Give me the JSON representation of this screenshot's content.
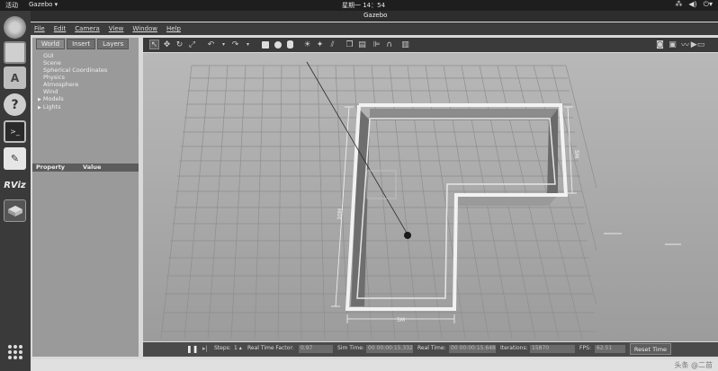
{
  "topbar": {
    "activities": "活动",
    "app_menu": "Gazebo ▾",
    "clock": "星期一 14：54",
    "tray": [
      "network-icon",
      "volume-icon",
      "power-icon"
    ]
  },
  "window": {
    "title": "Gazebo"
  },
  "menu": [
    "File",
    "Edit",
    "Camera",
    "View",
    "Window",
    "Help"
  ],
  "left_panel": {
    "tabs": [
      "World",
      "Insert",
      "Layers"
    ],
    "tree": [
      "GUI",
      "Scene",
      "Spherical Coordinates",
      "Physics",
      "Atmosphere",
      "Wind",
      "Models",
      "Lights"
    ],
    "property_header": "Property",
    "value_header": "Value"
  },
  "scene": {
    "dim_left": "10M",
    "dim_right": "5M",
    "dim_bottom": "5M"
  },
  "bottom": {
    "steps_label": "Steps:",
    "steps_value": "1 ▴",
    "rtf_label": "Real Time Factor:",
    "rtf_value": "0.97",
    "sim_time_label": "Sim Time:",
    "sim_time_value": "00 00:00:15.332",
    "real_time_label": "Real Time:",
    "real_time_value": "00 00:00:15.648",
    "iterations_label": "Iterations:",
    "iterations_value": "15870",
    "fps_label": "FPS:",
    "fps_value": "62.51",
    "reset_label": "Reset Time"
  },
  "watermark": "头条 @二苗"
}
